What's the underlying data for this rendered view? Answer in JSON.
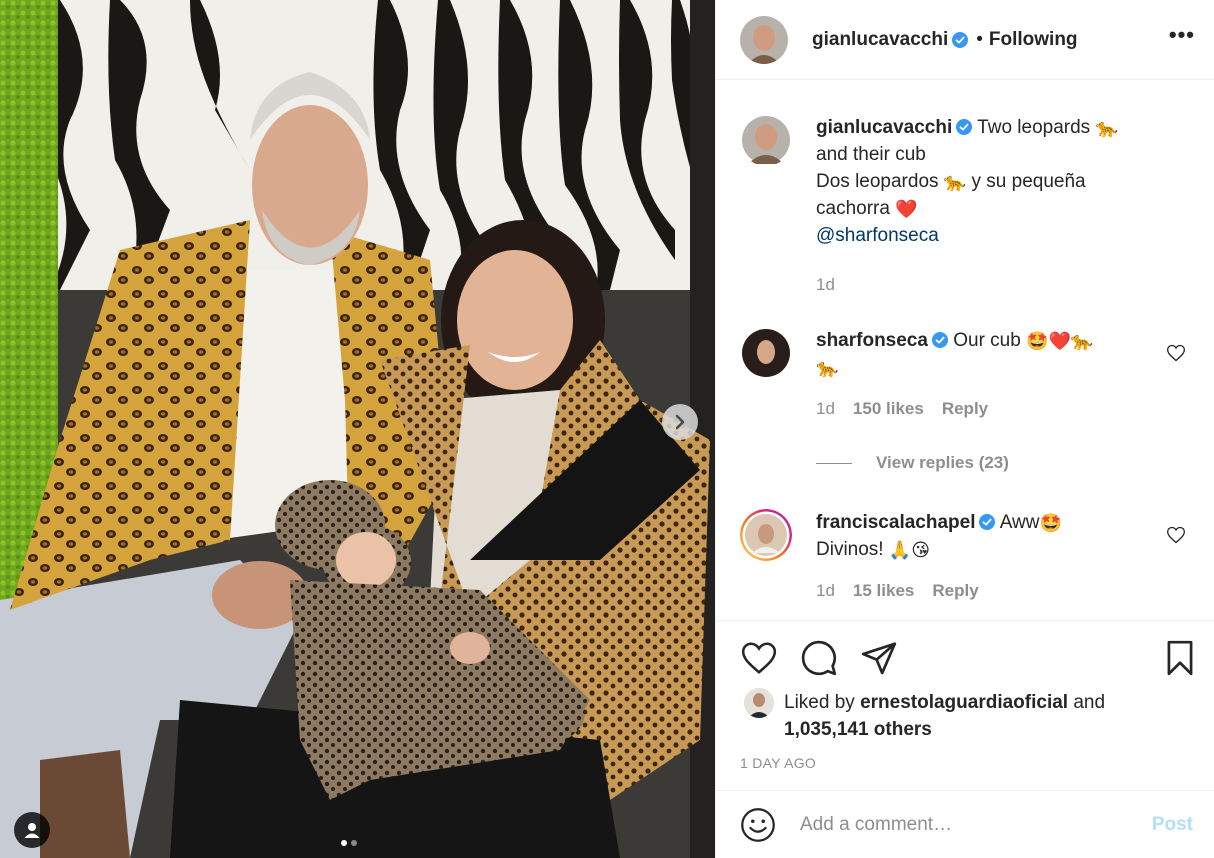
{
  "header": {
    "username": "gianlucavacchi",
    "separator": "•",
    "follow_status": "Following",
    "more_label": "•••"
  },
  "caption": {
    "username": "gianlucavacchi",
    "line1": "Two leopards",
    "line1_emoji": "🐆",
    "line2": "and their cub",
    "line3a": "Dos leopardos",
    "line3_emoji": "🐆",
    "line3b": "y su pequeña",
    "line4": "cachorra",
    "line4_emoji": "❤️",
    "mention": "@sharfonseca",
    "time": "1d"
  },
  "comments": [
    {
      "username": "sharfonseca",
      "text": "Our cub",
      "emojis": "🤩❤️🐆",
      "emoji_line2": "🐆",
      "time": "1d",
      "likes": "150 likes",
      "reply": "Reply",
      "view_replies": "View replies (23)"
    },
    {
      "username": "franciscalachapel",
      "text": "Aww",
      "emoji1": "🤩",
      "line2": "Divinos!",
      "emojis2": "🙏😘",
      "time": "1d",
      "likes": "15 likes",
      "reply": "Reply"
    }
  ],
  "likes": {
    "prefix": "Liked by",
    "liker": "ernestolaguardiaoficial",
    "connector": "and",
    "others": "1,035,141 others"
  },
  "timestamp": "1 DAY AGO",
  "add_comment": {
    "placeholder": "Add a comment…",
    "post_label": "Post"
  },
  "icons": {
    "verified": "verified-badge-icon",
    "heart": "heart-icon",
    "comment": "comment-icon",
    "share": "share-icon",
    "bookmark": "bookmark-icon",
    "emoji": "emoji-icon",
    "next": "chevron-right-icon",
    "user_tag": "person-icon"
  },
  "colors": {
    "verified_blue": "#3897f0",
    "mention": "#00376b",
    "muted": "#8e8e8e",
    "post_disabled": "#b2dffc"
  },
  "carousel": {
    "count": 2,
    "active_index": 1
  }
}
